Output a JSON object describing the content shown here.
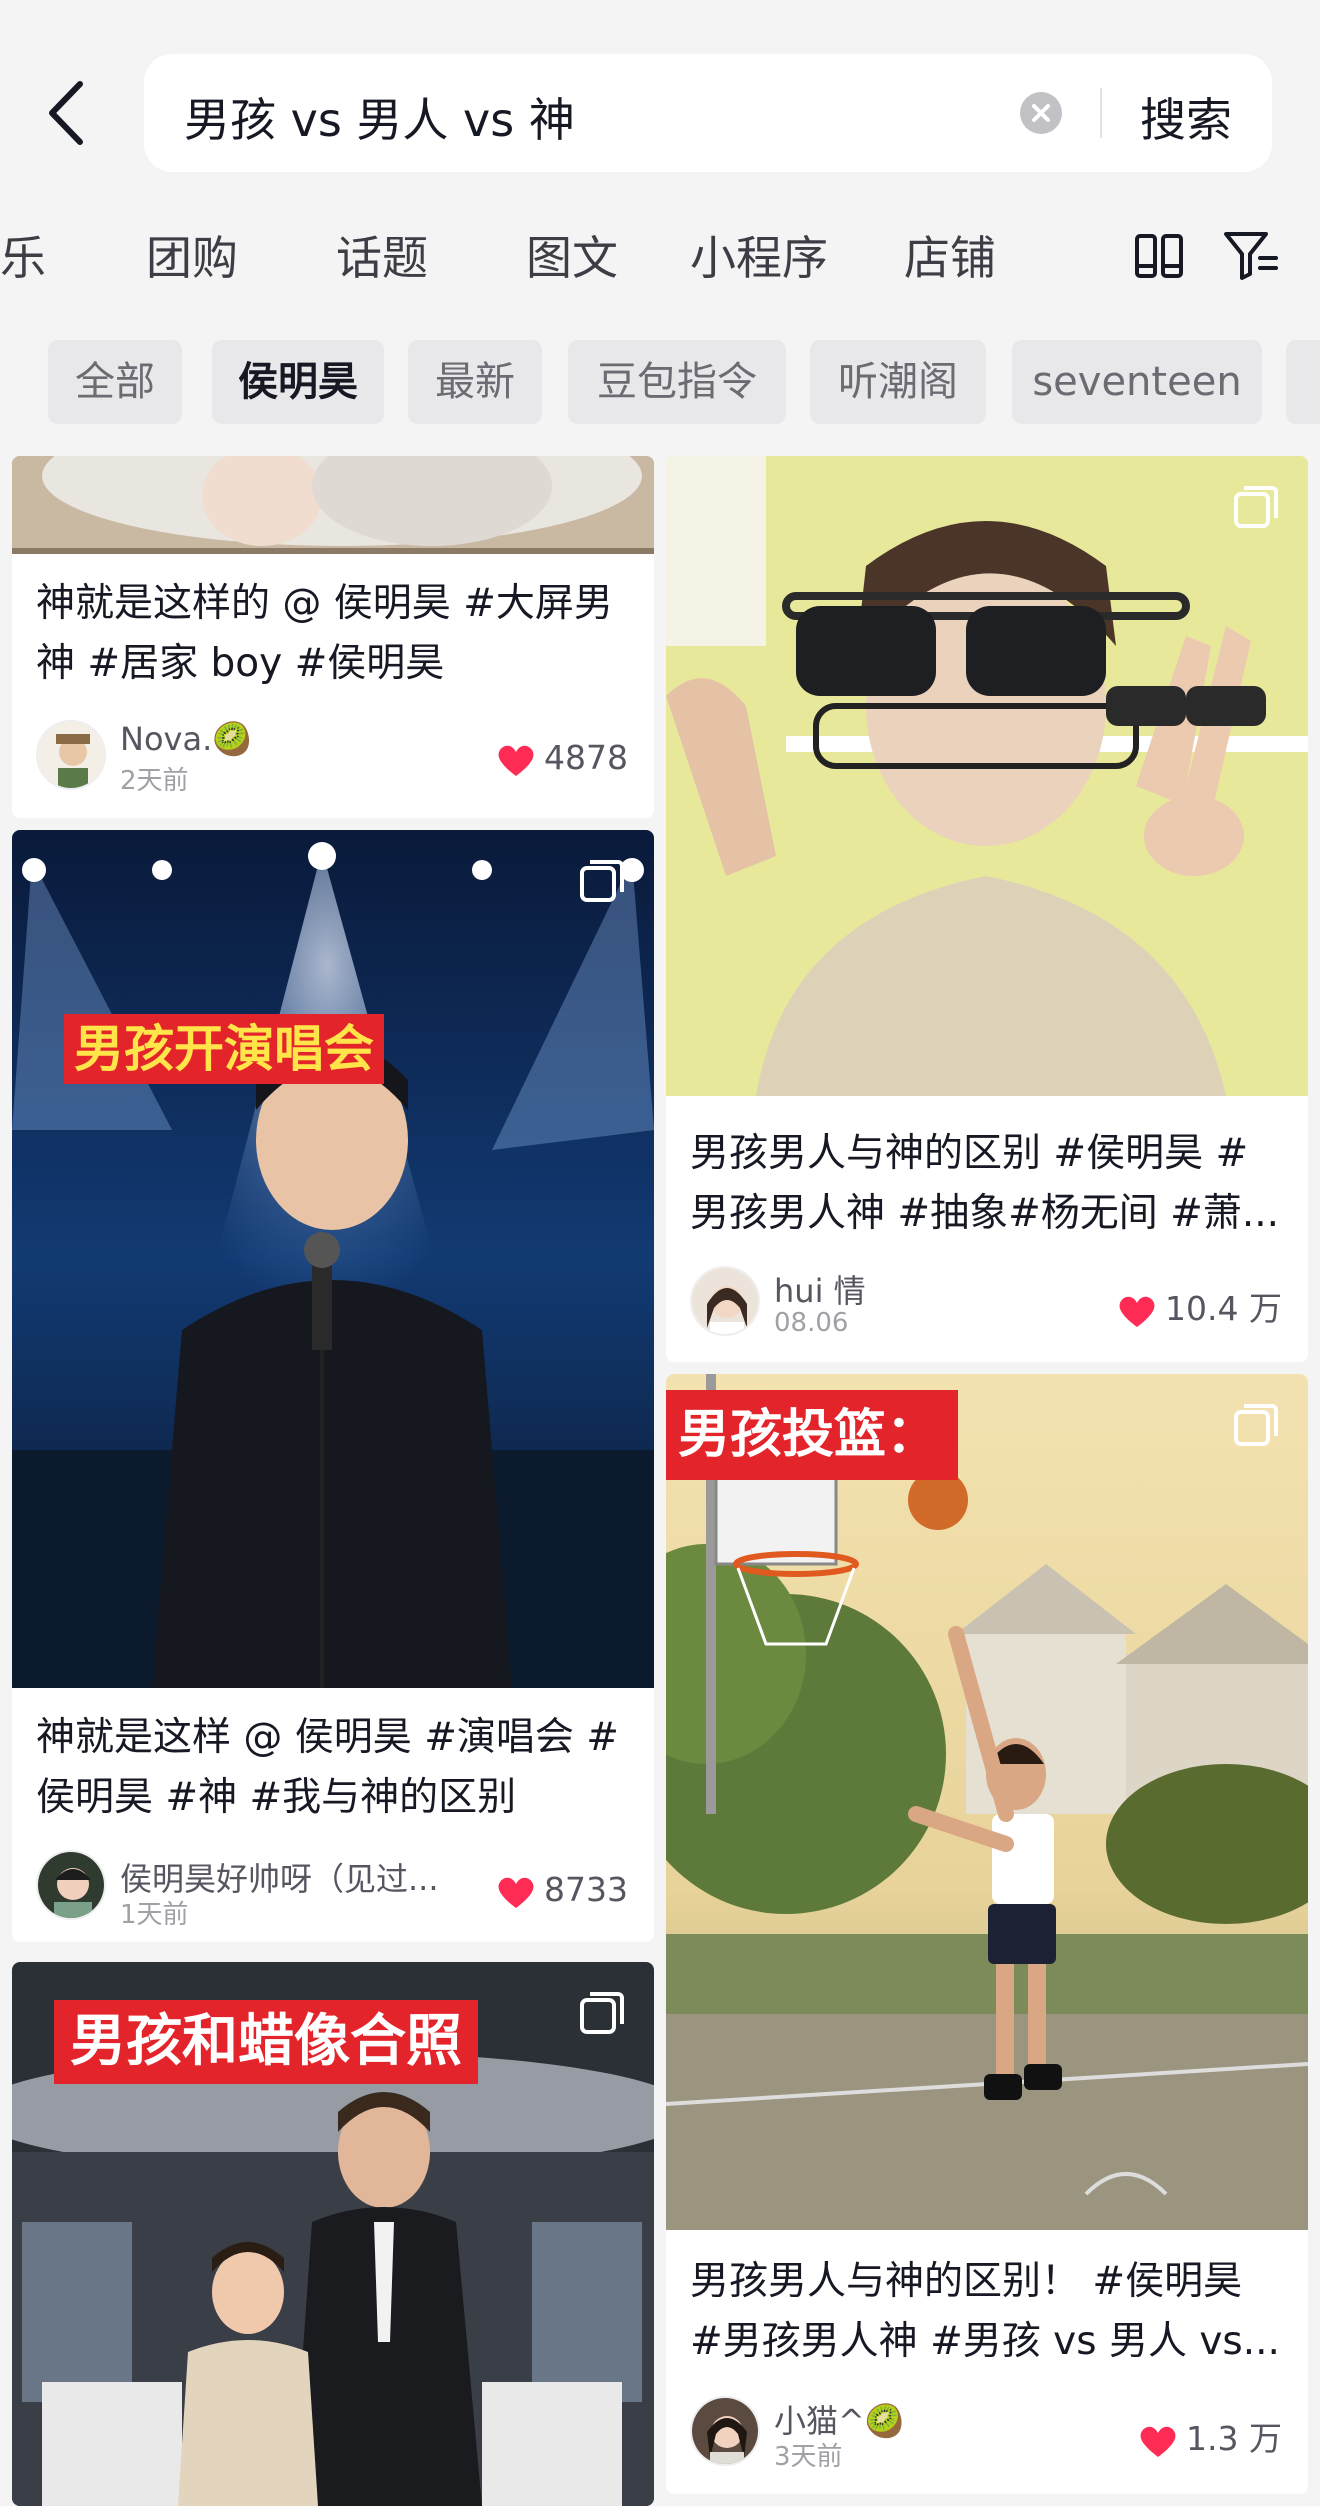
{
  "search": {
    "query": "男孩 vs 男人 vs 神",
    "button_label": "搜索"
  },
  "tabs": [
    "乐",
    "团购",
    "话题",
    "图文",
    "小程序",
    "店铺"
  ],
  "chips": [
    {
      "label": "全部",
      "active": false
    },
    {
      "label": "侯明昊",
      "active": true
    },
    {
      "label": "最新",
      "active": false
    },
    {
      "label": "豆包指令",
      "active": false
    },
    {
      "label": "听潮阁",
      "active": false
    },
    {
      "label": "seventeen",
      "active": false
    }
  ],
  "posts": {
    "left": [
      {
        "caption_lines": [
          "神就是这样的 @ 侯明昊 #大屏男",
          "神 #居家 boy #侯明昊"
        ],
        "author": "Nova.🥝",
        "date": "2天前",
        "likes": "4878"
      },
      {
        "overlay": "男孩开演唱会",
        "caption_lines": [
          "神就是这样 @ 侯明昊 #演唱会 #",
          "侯明昊 #神 #我与神的区别"
        ],
        "author": "侯明昊好帅呀（见过...",
        "date": "1天前",
        "likes": "8733"
      },
      {
        "overlay": "男孩和蜡像合照"
      }
    ],
    "right": [
      {
        "caption_lines": [
          "男孩男人与神的区别 #侯明昊 #",
          "男孩男人神 #抽象#杨无间 #萧..."
        ],
        "author": "hui 情",
        "date": "08.06",
        "likes": "10.4 万"
      },
      {
        "overlay": "男孩投篮：",
        "caption_lines": [
          "男孩男人与神的区别！ #侯明昊",
          "#男孩男人神 #男孩 vs 男人 vs..."
        ],
        "author": "小猫^🥝",
        "date": "3天前",
        "likes": "1.3 万"
      }
    ]
  },
  "colors": {
    "heart": "#fe2c55",
    "overlay_bg": "#e4242b",
    "overlay_text_yellow": "#ffe44a"
  },
  "icons": [
    "back-chevron-icon",
    "clear-icon",
    "dual-column-layout-icon",
    "filter-icon",
    "heart-icon",
    "multi-image-icon"
  ]
}
